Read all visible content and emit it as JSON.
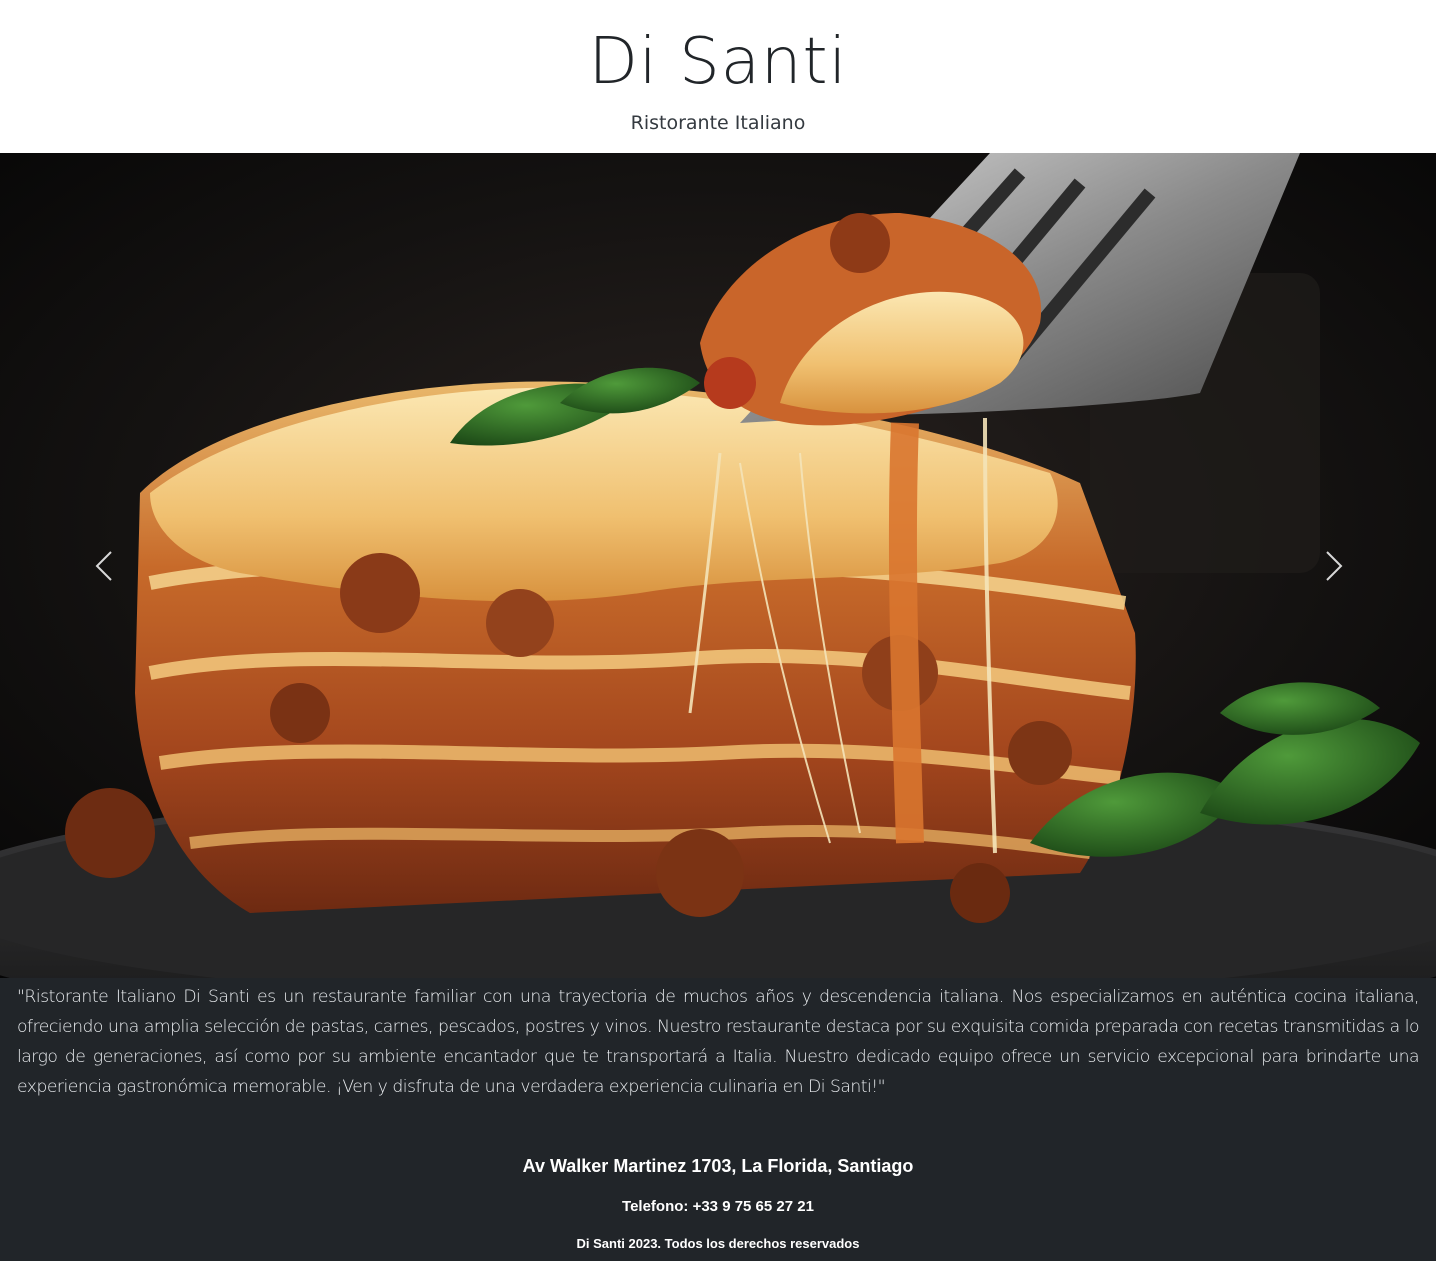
{
  "header": {
    "title": "Di Santi",
    "subtitle": "Ristorante Italiano"
  },
  "carousel": {
    "image_label": "lasagna-photo",
    "prev_icon": "chevron-left-icon",
    "next_icon": "chevron-right-icon"
  },
  "about": {
    "text": "\"Ristorante Italiano Di Santi es un restaurante familiar con una trayectoria de muchos años y descendencia italiana. Nos especializamos en auténtica cocina italiana, ofreciendo una amplia selección de pastas, carnes, pescados, postres y vinos. Nuestro restaurante destaca por su exquisita comida preparada con recetas transmitidas a lo largo de generaciones, así como por su ambiente encantador que te transportará a Italia. Nuestro dedicado equipo ofrece un servicio excepcional para brindarte una experiencia gastronómica memorable. ¡Ven y disfruta de una verdadera experiencia culinaria en Di Santi!\""
  },
  "footer": {
    "address": "Av Walker Martinez 1703, La Florida, Santiago",
    "phone": "Telefono: +33 9 75 65 27 21",
    "copyright": "Di Santi 2023. Todos los derechos reservados"
  },
  "colors": {
    "footer_bg": "#212529",
    "header_bg": "#ffffff",
    "text_dark": "#212529"
  }
}
